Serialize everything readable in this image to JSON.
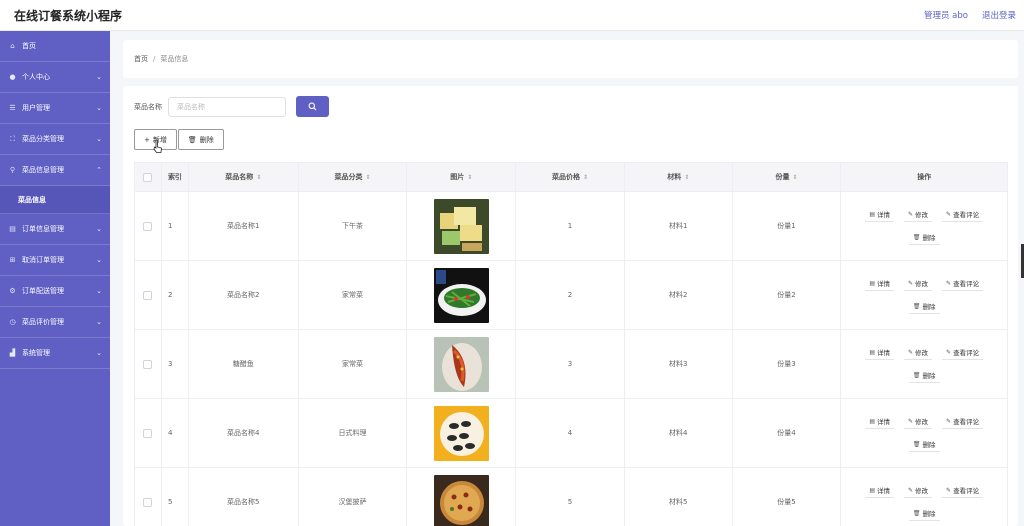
{
  "app": {
    "title": "在线订餐系统小程序"
  },
  "header": {
    "user": "管理员 abo",
    "logout": "退出登录"
  },
  "sidebar": {
    "items": [
      {
        "label": "首页",
        "icon": "home-icon",
        "glyph": "⌂",
        "expandable": false
      },
      {
        "label": "个人中心",
        "icon": "user-icon",
        "glyph": "●",
        "expandable": true
      },
      {
        "label": "用户管理",
        "icon": "list-icon",
        "glyph": "☰",
        "expandable": true
      },
      {
        "label": "菜品分类管理",
        "icon": "category-icon",
        "glyph": "⛶",
        "expandable": true
      },
      {
        "label": "菜品信息管理",
        "icon": "location-icon",
        "glyph": "⚲",
        "expandable": true,
        "expanded": true
      },
      {
        "label": "订单信息管理",
        "icon": "order-icon",
        "glyph": "▤",
        "expandable": true
      },
      {
        "label": "取消订单管理",
        "icon": "grid-icon",
        "glyph": "⊞",
        "expandable": true
      },
      {
        "label": "订单配送管理",
        "icon": "settings-icon",
        "glyph": "⚙",
        "expandable": true
      },
      {
        "label": "菜品评价管理",
        "icon": "clock-icon",
        "glyph": "◷",
        "expandable": true
      },
      {
        "label": "系统管理",
        "icon": "chart-icon",
        "glyph": "▟",
        "expandable": true
      }
    ],
    "sub_item": "菜品信息"
  },
  "breadcrumb": {
    "home": "首页",
    "separator": "/",
    "current": "菜品信息"
  },
  "search": {
    "label": "菜品名称",
    "placeholder": "菜品名称"
  },
  "actions": {
    "add": "新增",
    "delete": "删除"
  },
  "table": {
    "headers": {
      "index": "索引",
      "name": "菜品名称",
      "category": "菜品分类",
      "image": "图片",
      "price": "菜品价格",
      "material": "材料",
      "portion": "份量",
      "ops": "操作"
    },
    "ops": {
      "detail": "详情",
      "edit": "修改",
      "reviews": "查看评论",
      "delete": "删除"
    },
    "rows": [
      {
        "index": "1",
        "name": "菜品名称1",
        "category": "下午茶",
        "price": "1",
        "material": "材料1",
        "portion": "份量1"
      },
      {
        "index": "2",
        "name": "菜品名称2",
        "category": "家常菜",
        "price": "2",
        "material": "材料2",
        "portion": "份量2"
      },
      {
        "index": "3",
        "name": "糖醋鱼",
        "category": "家常菜",
        "price": "3",
        "material": "材料3",
        "portion": "份量3"
      },
      {
        "index": "4",
        "name": "菜品名称4",
        "category": "日式料理",
        "price": "4",
        "material": "材料4",
        "portion": "份量4"
      },
      {
        "index": "5",
        "name": "菜品名称5",
        "category": "汉堡披萨",
        "price": "5",
        "material": "材料5",
        "portion": "份量5"
      }
    ]
  },
  "colors": {
    "accent": "#5f5fc4",
    "sidebar": "#5f5fc4",
    "link": "#5b63c9"
  }
}
